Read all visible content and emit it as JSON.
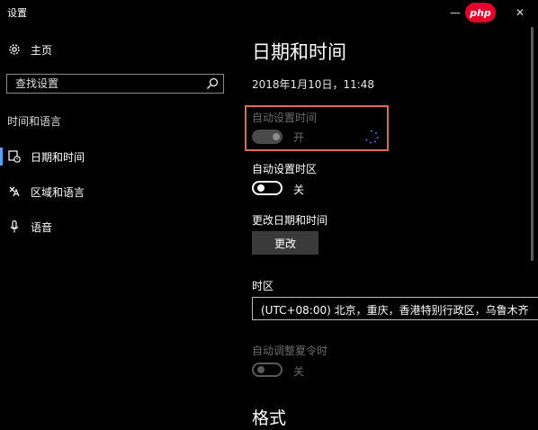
{
  "window": {
    "title": "设置",
    "badge": "php",
    "minimize_glyph": "—",
    "close_glyph": "✕"
  },
  "sidebar": {
    "home_label": "主页",
    "search_placeholder": "查找设置",
    "section_label": "时间和语言",
    "items": [
      {
        "label": "日期和时间",
        "icon": "calendar-clock-icon",
        "active": true
      },
      {
        "label": "区域和语言",
        "icon": "region-language-icon",
        "active": false
      },
      {
        "label": "语音",
        "icon": "microphone-icon",
        "active": false
      }
    ]
  },
  "main": {
    "title": "日期和时间",
    "current_datetime": "2018年1月10日，11:48",
    "auto_time": {
      "label": "自动设置时间",
      "state_label": "开",
      "enabled": false,
      "on": true
    },
    "auto_timezone": {
      "label": "自动设置时区",
      "state_label": "关",
      "on": false
    },
    "change_datetime": {
      "label": "更改日期和时间",
      "button": "更改"
    },
    "timezone": {
      "label": "时区",
      "value": "(UTC+08:00) 北京，重庆，香港特别行政区，乌鲁木齐"
    },
    "daylight": {
      "label": "自动调整夏令时",
      "state_label": "关",
      "enabled": false,
      "on": false
    },
    "format_title": "格式"
  },
  "colors": {
    "background": "#000000",
    "accent": "#5aa0ff",
    "highlight": "#e06a52",
    "badge": "#e4002b"
  }
}
